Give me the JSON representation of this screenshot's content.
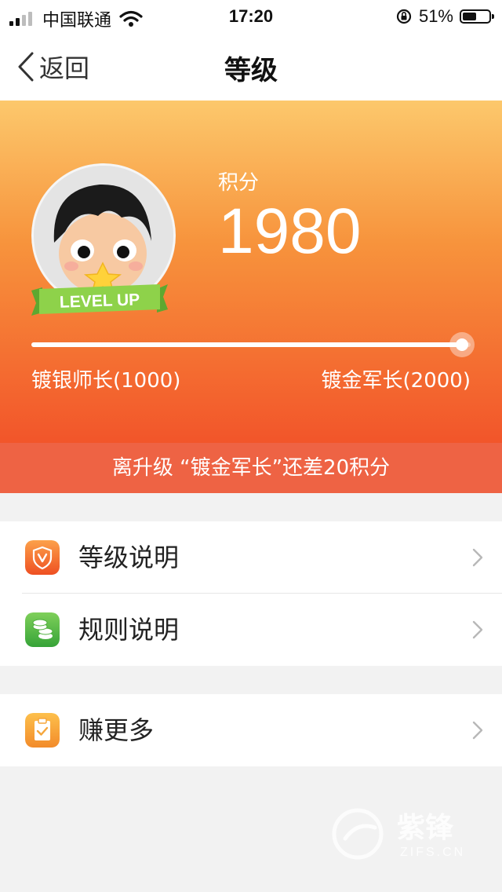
{
  "status_bar": {
    "carrier": "中国联通",
    "time": "17:20",
    "battery_percent": "51%",
    "battery_level": 0.51
  },
  "nav": {
    "back_label": "返回",
    "title": "等级"
  },
  "level": {
    "score_label": "积分",
    "score": "1980",
    "badge_text": "LEVEL UP",
    "progress": 0.98,
    "current_tier": "镀银师长(1000)",
    "next_tier": "镀金军长(2000)",
    "tip": "离升级 “镀金军长”还差20积分"
  },
  "menu_groups": [
    {
      "items": [
        {
          "label": "等级说明",
          "icon": "shield-v-icon",
          "color": "#f06b2d"
        },
        {
          "label": "规则说明",
          "icon": "coins-icon",
          "color": "#4caf3c"
        }
      ]
    },
    {
      "items": [
        {
          "label": "赚更多",
          "icon": "clipboard-check-icon",
          "color": "#f7a23a"
        }
      ]
    }
  ],
  "watermark": {
    "brand": "紫锋",
    "domain": "ZIFS.CN"
  },
  "colors": {
    "hero_top": "#fcc86c",
    "hero_bottom": "#f2552a",
    "tip_bar": "#ee6344"
  }
}
